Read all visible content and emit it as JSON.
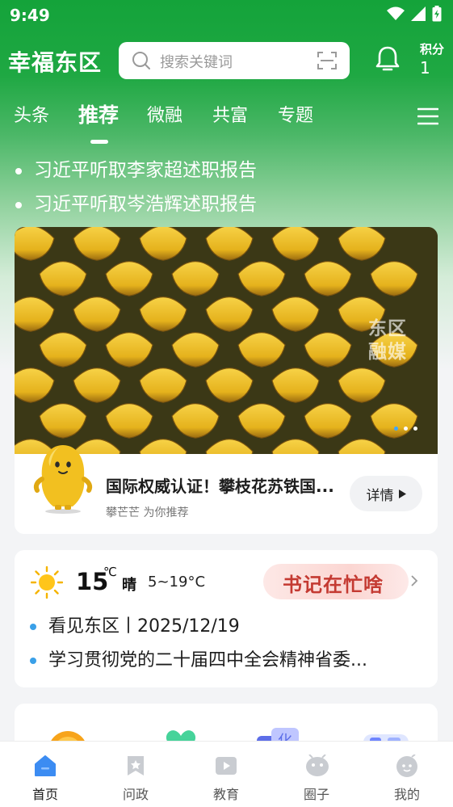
{
  "status": {
    "time": "9:49"
  },
  "header": {
    "title": "幸福东区",
    "search_placeholder": "搜索关键词",
    "points_label": "积分",
    "points_value": "1"
  },
  "tabs": [
    {
      "label": "头条",
      "active": false
    },
    {
      "label": "推荐",
      "active": true
    },
    {
      "label": "微融",
      "active": false
    },
    {
      "label": "共富",
      "active": false
    },
    {
      "label": "专题",
      "active": false
    }
  ],
  "headlines": [
    "习近平听取李家超述职报告",
    "习近平听取岑浩辉述职报告"
  ],
  "banner": {
    "watermark_line1": "东区",
    "watermark_line2": "融媒",
    "slides": 3,
    "active_slide": 1,
    "title": "国际权威认证！攀枝花苏铁国...",
    "subtitle": "攀芒芒 为你推荐",
    "detail_label": "详情"
  },
  "weather": {
    "temp": "15",
    "unit": "℃",
    "condition": "晴",
    "range": "5~19°C",
    "promo": "书记在忙啥"
  },
  "news": [
    "看见东区丨2025/12/19",
    "学习贯彻党的二十届四中全会精神省委..."
  ],
  "nav": [
    {
      "label": "首页",
      "icon": "home-icon",
      "active": true
    },
    {
      "label": "问政",
      "icon": "bookmark-star-icon",
      "active": false
    },
    {
      "label": "教育",
      "icon": "video-play-icon",
      "active": false
    },
    {
      "label": "圈子",
      "icon": "circle-community-icon",
      "active": false
    },
    {
      "label": "我的",
      "icon": "profile-icon",
      "active": false
    }
  ],
  "colors": {
    "brand_green": "#14a33a",
    "accent_blue": "#3aa0e8",
    "promo_red": "#c43a32"
  }
}
